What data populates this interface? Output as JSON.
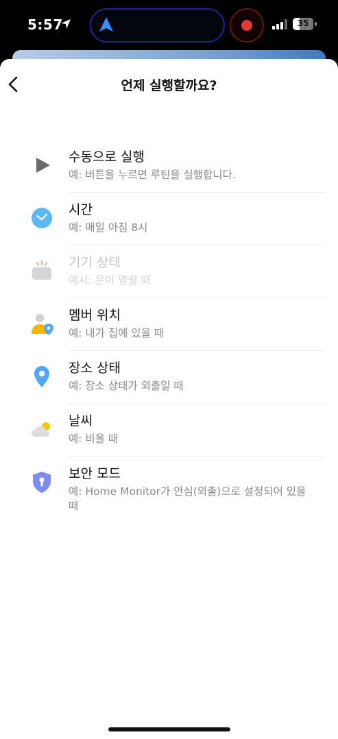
{
  "status_bar": {
    "time": "5:57",
    "battery": "35",
    "battery_level": 0.35
  },
  "header": {
    "title": "언제 실행할까요?"
  },
  "options": [
    {
      "title": "수동으로 실행",
      "desc": "예: 버튼을 누르면 루틴을 실행합니다.",
      "icon": "play-icon",
      "enabled": true
    },
    {
      "title": "시간",
      "desc": "예: 매일 아침 8시",
      "icon": "clock-icon",
      "enabled": true
    },
    {
      "title": "기기 상태",
      "desc": "예시: 문이 열릴 때",
      "icon": "device-icon",
      "enabled": false
    },
    {
      "title": "멤버 위치",
      "desc": "예: 내가 집에 있을 때",
      "icon": "member-location-icon",
      "enabled": true
    },
    {
      "title": "장소 상태",
      "desc": "예: 장소 상태가 외출일 때",
      "icon": "location-pin-icon",
      "enabled": true
    },
    {
      "title": "날씨",
      "desc": "예: 비올 때",
      "icon": "weather-icon",
      "enabled": true
    },
    {
      "title": "보안 모드",
      "desc": "예: Home Monitor가 안심(외출)으로 설정되어 있을 때",
      "icon": "security-shield-icon",
      "enabled": true
    }
  ],
  "colors": {
    "accent_blue": "#4ea8f5",
    "disabled_text": "#c4c4c4",
    "desc_text": "#8a8a8a"
  }
}
